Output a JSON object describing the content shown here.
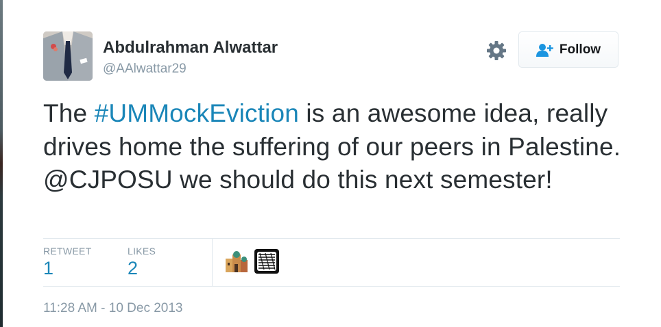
{
  "user": {
    "display_name": "Abdulrahman Alwattar",
    "handle": "@AAlwattar29"
  },
  "header": {
    "settings_icon": "gear-icon",
    "follow_label": "Follow",
    "follow_icon": "add-person-icon"
  },
  "tweet": {
    "before_hashtag": "The ",
    "hashtag": "#UMMockEviction",
    "after_hashtag": " is an awesome idea, really drives home the suffering of our peers in Palestine. ",
    "mention": "@CJPOSU",
    "after_mention": " we should do this next semester!"
  },
  "stats": {
    "retweet_label": "RETWEET",
    "retweet_count": "1",
    "likes_label": "LIKES",
    "likes_count": "2"
  },
  "timestamp": "11:28 AM - 10 Dec 2013",
  "colors": {
    "link": "#1a86b8",
    "muted": "#8899a6",
    "text": "#292f33",
    "divider": "#e1e8ed"
  }
}
